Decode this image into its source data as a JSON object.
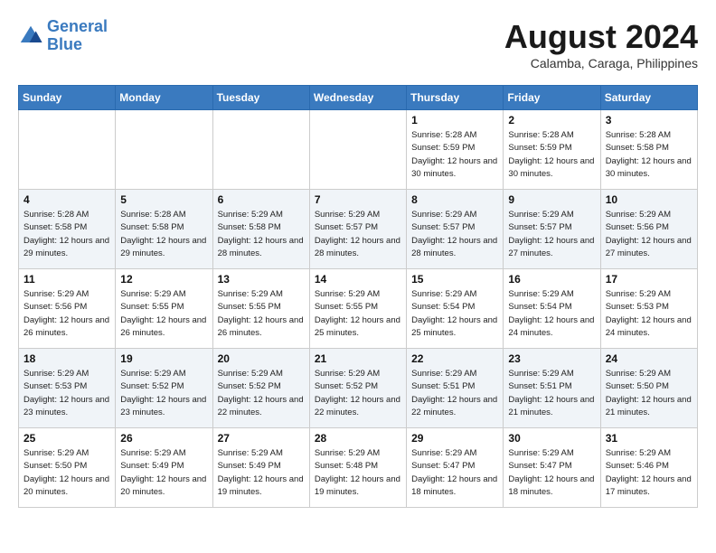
{
  "header": {
    "logo_line1": "General",
    "logo_line2": "Blue",
    "month_year": "August 2024",
    "location": "Calamba, Caraga, Philippines"
  },
  "weekdays": [
    "Sunday",
    "Monday",
    "Tuesday",
    "Wednesday",
    "Thursday",
    "Friday",
    "Saturday"
  ],
  "weeks": [
    [
      {
        "day": "",
        "sunrise": "",
        "sunset": "",
        "daylight": ""
      },
      {
        "day": "",
        "sunrise": "",
        "sunset": "",
        "daylight": ""
      },
      {
        "day": "",
        "sunrise": "",
        "sunset": "",
        "daylight": ""
      },
      {
        "day": "",
        "sunrise": "",
        "sunset": "",
        "daylight": ""
      },
      {
        "day": "1",
        "sunrise": "Sunrise: 5:28 AM",
        "sunset": "Sunset: 5:59 PM",
        "daylight": "Daylight: 12 hours and 30 minutes."
      },
      {
        "day": "2",
        "sunrise": "Sunrise: 5:28 AM",
        "sunset": "Sunset: 5:59 PM",
        "daylight": "Daylight: 12 hours and 30 minutes."
      },
      {
        "day": "3",
        "sunrise": "Sunrise: 5:28 AM",
        "sunset": "Sunset: 5:58 PM",
        "daylight": "Daylight: 12 hours and 30 minutes."
      }
    ],
    [
      {
        "day": "4",
        "sunrise": "Sunrise: 5:28 AM",
        "sunset": "Sunset: 5:58 PM",
        "daylight": "Daylight: 12 hours and 29 minutes."
      },
      {
        "day": "5",
        "sunrise": "Sunrise: 5:28 AM",
        "sunset": "Sunset: 5:58 PM",
        "daylight": "Daylight: 12 hours and 29 minutes."
      },
      {
        "day": "6",
        "sunrise": "Sunrise: 5:29 AM",
        "sunset": "Sunset: 5:58 PM",
        "daylight": "Daylight: 12 hours and 28 minutes."
      },
      {
        "day": "7",
        "sunrise": "Sunrise: 5:29 AM",
        "sunset": "Sunset: 5:57 PM",
        "daylight": "Daylight: 12 hours and 28 minutes."
      },
      {
        "day": "8",
        "sunrise": "Sunrise: 5:29 AM",
        "sunset": "Sunset: 5:57 PM",
        "daylight": "Daylight: 12 hours and 28 minutes."
      },
      {
        "day": "9",
        "sunrise": "Sunrise: 5:29 AM",
        "sunset": "Sunset: 5:57 PM",
        "daylight": "Daylight: 12 hours and 27 minutes."
      },
      {
        "day": "10",
        "sunrise": "Sunrise: 5:29 AM",
        "sunset": "Sunset: 5:56 PM",
        "daylight": "Daylight: 12 hours and 27 minutes."
      }
    ],
    [
      {
        "day": "11",
        "sunrise": "Sunrise: 5:29 AM",
        "sunset": "Sunset: 5:56 PM",
        "daylight": "Daylight: 12 hours and 26 minutes."
      },
      {
        "day": "12",
        "sunrise": "Sunrise: 5:29 AM",
        "sunset": "Sunset: 5:55 PM",
        "daylight": "Daylight: 12 hours and 26 minutes."
      },
      {
        "day": "13",
        "sunrise": "Sunrise: 5:29 AM",
        "sunset": "Sunset: 5:55 PM",
        "daylight": "Daylight: 12 hours and 26 minutes."
      },
      {
        "day": "14",
        "sunrise": "Sunrise: 5:29 AM",
        "sunset": "Sunset: 5:55 PM",
        "daylight": "Daylight: 12 hours and 25 minutes."
      },
      {
        "day": "15",
        "sunrise": "Sunrise: 5:29 AM",
        "sunset": "Sunset: 5:54 PM",
        "daylight": "Daylight: 12 hours and 25 minutes."
      },
      {
        "day": "16",
        "sunrise": "Sunrise: 5:29 AM",
        "sunset": "Sunset: 5:54 PM",
        "daylight": "Daylight: 12 hours and 24 minutes."
      },
      {
        "day": "17",
        "sunrise": "Sunrise: 5:29 AM",
        "sunset": "Sunset: 5:53 PM",
        "daylight": "Daylight: 12 hours and 24 minutes."
      }
    ],
    [
      {
        "day": "18",
        "sunrise": "Sunrise: 5:29 AM",
        "sunset": "Sunset: 5:53 PM",
        "daylight": "Daylight: 12 hours and 23 minutes."
      },
      {
        "day": "19",
        "sunrise": "Sunrise: 5:29 AM",
        "sunset": "Sunset: 5:52 PM",
        "daylight": "Daylight: 12 hours and 23 minutes."
      },
      {
        "day": "20",
        "sunrise": "Sunrise: 5:29 AM",
        "sunset": "Sunset: 5:52 PM",
        "daylight": "Daylight: 12 hours and 22 minutes."
      },
      {
        "day": "21",
        "sunrise": "Sunrise: 5:29 AM",
        "sunset": "Sunset: 5:52 PM",
        "daylight": "Daylight: 12 hours and 22 minutes."
      },
      {
        "day": "22",
        "sunrise": "Sunrise: 5:29 AM",
        "sunset": "Sunset: 5:51 PM",
        "daylight": "Daylight: 12 hours and 22 minutes."
      },
      {
        "day": "23",
        "sunrise": "Sunrise: 5:29 AM",
        "sunset": "Sunset: 5:51 PM",
        "daylight": "Daylight: 12 hours and 21 minutes."
      },
      {
        "day": "24",
        "sunrise": "Sunrise: 5:29 AM",
        "sunset": "Sunset: 5:50 PM",
        "daylight": "Daylight: 12 hours and 21 minutes."
      }
    ],
    [
      {
        "day": "25",
        "sunrise": "Sunrise: 5:29 AM",
        "sunset": "Sunset: 5:50 PM",
        "daylight": "Daylight: 12 hours and 20 minutes."
      },
      {
        "day": "26",
        "sunrise": "Sunrise: 5:29 AM",
        "sunset": "Sunset: 5:49 PM",
        "daylight": "Daylight: 12 hours and 20 minutes."
      },
      {
        "day": "27",
        "sunrise": "Sunrise: 5:29 AM",
        "sunset": "Sunset: 5:49 PM",
        "daylight": "Daylight: 12 hours and 19 minutes."
      },
      {
        "day": "28",
        "sunrise": "Sunrise: 5:29 AM",
        "sunset": "Sunset: 5:48 PM",
        "daylight": "Daylight: 12 hours and 19 minutes."
      },
      {
        "day": "29",
        "sunrise": "Sunrise: 5:29 AM",
        "sunset": "Sunset: 5:47 PM",
        "daylight": "Daylight: 12 hours and 18 minutes."
      },
      {
        "day": "30",
        "sunrise": "Sunrise: 5:29 AM",
        "sunset": "Sunset: 5:47 PM",
        "daylight": "Daylight: 12 hours and 18 minutes."
      },
      {
        "day": "31",
        "sunrise": "Sunrise: 5:29 AM",
        "sunset": "Sunset: 5:46 PM",
        "daylight": "Daylight: 12 hours and 17 minutes."
      }
    ]
  ]
}
